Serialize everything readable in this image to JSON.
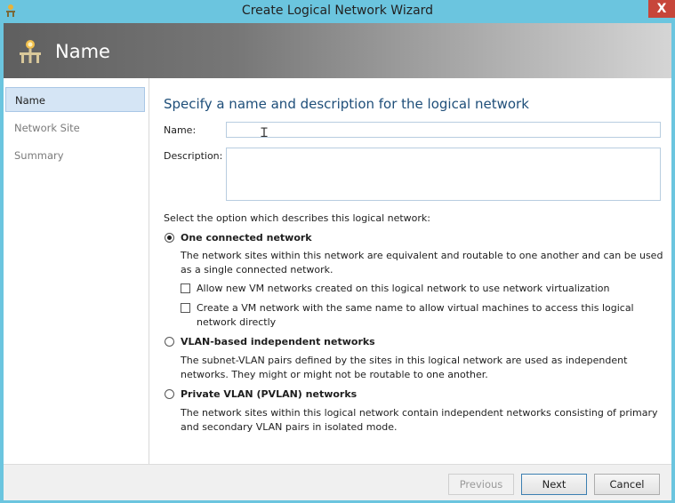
{
  "window": {
    "title": "Create Logical Network Wizard",
    "close_glyph": "X"
  },
  "header": {
    "title": "Name"
  },
  "sidebar": {
    "items": [
      {
        "label": "Name",
        "active": true
      },
      {
        "label": "Network Site",
        "active": false
      },
      {
        "label": "Summary",
        "active": false
      }
    ]
  },
  "main": {
    "heading": "Specify a name and description for the logical network",
    "name_label": "Name:",
    "name_value": "",
    "description_label": "Description:",
    "description_value": "",
    "option_prompt": "Select the option which describes this logical network:",
    "options": [
      {
        "label": "One connected network",
        "selected": true,
        "description": "The network sites within this network are equivalent and routable to one another and can be used as a single connected network.",
        "checkboxes": [
          {
            "label": "Allow new VM networks created on this logical network to use network virtualization",
            "checked": false
          },
          {
            "label": "Create a VM network with the same name to allow virtual machines to access this logical network directly",
            "checked": false
          }
        ]
      },
      {
        "label": "VLAN-based independent networks",
        "selected": false,
        "description": "The subnet-VLAN pairs defined by the sites in this logical network are used as independent networks. They might or might not be routable to one another."
      },
      {
        "label": "Private VLAN (PVLAN) networks",
        "selected": false,
        "description": "The network sites within this logical network contain independent networks consisting of primary and secondary VLAN pairs in isolated mode."
      }
    ]
  },
  "footer": {
    "previous_label": "Previous",
    "next_label": "Next",
    "cancel_label": "Cancel"
  },
  "colors": {
    "frame": "#6bc5df",
    "close": "#c7463a",
    "heading": "#1e4e79",
    "nav_active": "#d5e5f5"
  }
}
